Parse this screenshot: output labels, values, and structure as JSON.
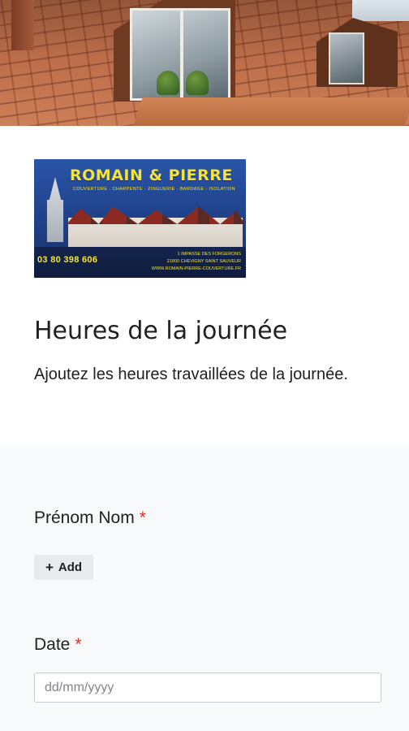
{
  "header_image": {
    "icon": "roof-dormer-photo"
  },
  "logo": {
    "brand": "ROMAIN & PIERRE",
    "services": "COUVERTURE - CHARPENTE - ZINGUERIE - BARDAGE - ISOLATION",
    "phone": "03 80 398 606",
    "address_line1": "1 IMPASSE DES FORGERONS",
    "address_line2": "21800 CHEVIGNY SAINT SAUVEUR",
    "website": "WWW.ROMAIN-PIERRE-COUVERTURE.FR"
  },
  "form": {
    "title": "Heures de la journée",
    "description": "Ajoutez les heures travaillées de la journée."
  },
  "fields": {
    "name": {
      "label": "Prénom Nom",
      "required_mark": "*",
      "add_label": "Add"
    },
    "date": {
      "label": "Date",
      "required_mark": "*",
      "placeholder": "dd/mm/yyyy",
      "value": ""
    }
  },
  "colors": {
    "required": "#d93025",
    "form_body_background": "#f8f9fa",
    "add_button_background": "#e8eaed",
    "logo_text": "#f3e33a",
    "logo_background": "#1e3f86"
  }
}
